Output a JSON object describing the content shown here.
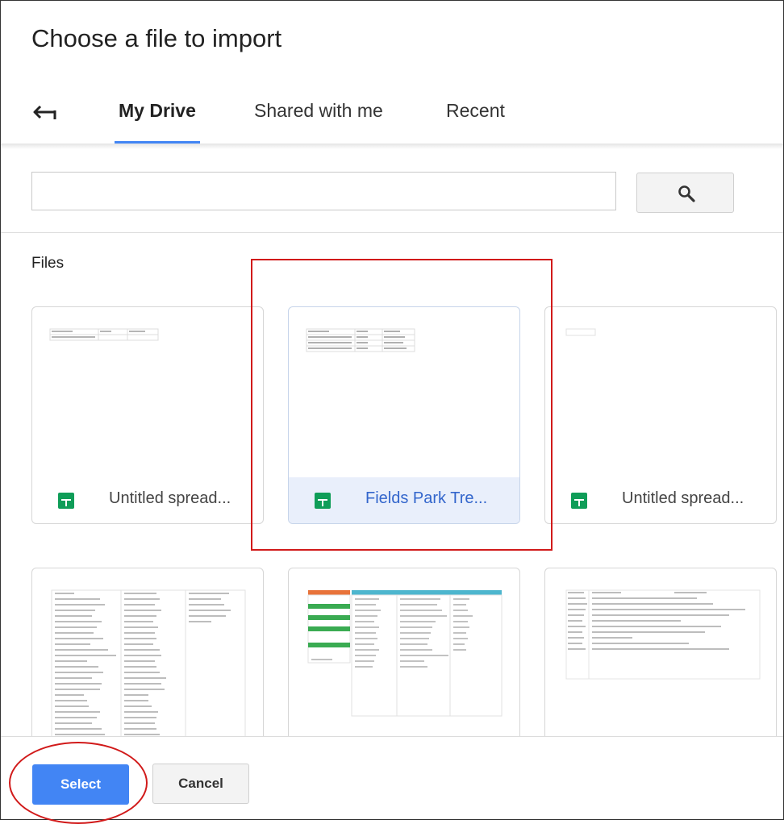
{
  "dialog": {
    "title": "Choose a file to import"
  },
  "tabs": [
    {
      "label": "My Drive",
      "active": true
    },
    {
      "label": "Shared with me",
      "active": false
    },
    {
      "label": "Recent",
      "active": false
    }
  ],
  "search": {
    "value": "",
    "placeholder": ""
  },
  "files_section": {
    "label": "Files"
  },
  "files": [
    {
      "name": "Untitled spread...",
      "type": "spreadsheet",
      "selected": false
    },
    {
      "name": "Fields Park Tre...",
      "type": "spreadsheet",
      "selected": true
    },
    {
      "name": "Untitled spread...",
      "type": "spreadsheet",
      "selected": false
    }
  ],
  "footer": {
    "select_label": "Select",
    "cancel_label": "Cancel"
  },
  "colors": {
    "accent": "#4285f4",
    "sheets_green": "#0f9d58",
    "selected_bg": "#e9effb",
    "annotation_red": "#d11a1a"
  },
  "icons": [
    "back-arrow-icon",
    "search-icon",
    "spreadsheet-icon"
  ]
}
